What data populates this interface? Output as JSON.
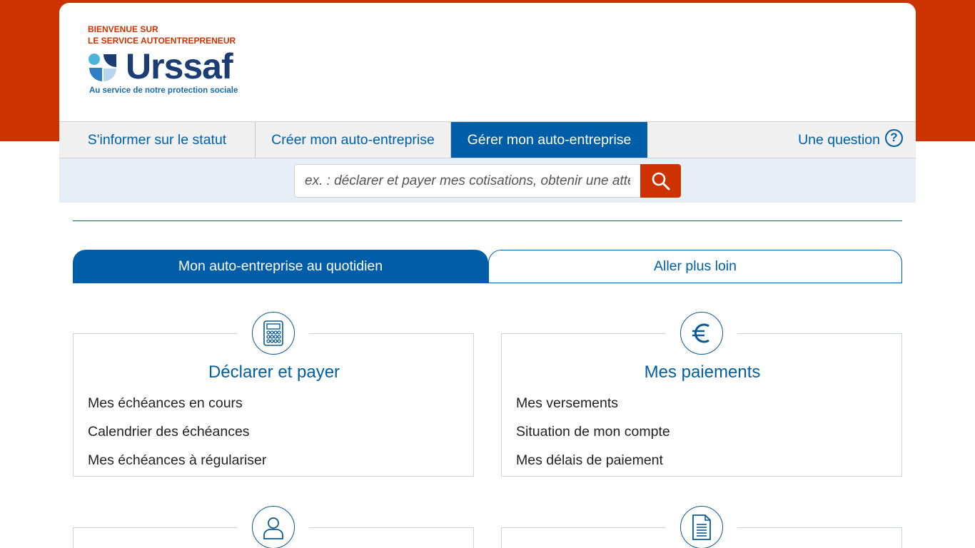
{
  "header": {
    "welcome_line1": "BIENVENUE SUR",
    "welcome_line2": "LE SERVICE AUTOENTREPRENEUR",
    "logo_text": "Urssaf",
    "tagline": "Au service de notre protection sociale",
    "brand_color": "#cc3300"
  },
  "nav": {
    "items": [
      {
        "label": "S'informer sur le statut"
      },
      {
        "label": "Créer mon auto-entreprise"
      },
      {
        "label": "Gérer mon auto-entreprise"
      }
    ],
    "question_label": "Une question",
    "question_icon": "?"
  },
  "search": {
    "placeholder": "ex. : déclarer et payer mes cotisations, obtenir une attestation",
    "button_icon": "search-icon"
  },
  "tabs": [
    {
      "label": "Mon auto-entreprise au quotidien"
    },
    {
      "label": "Aller plus loin"
    }
  ],
  "cards": [
    {
      "icon": "calculator-icon",
      "title": "Déclarer et payer",
      "links": [
        "Mes échéances en cours",
        "Calendrier des échéances",
        "Mes échéances à régulariser"
      ]
    },
    {
      "icon": "euro-icon",
      "title": "Mes paiements",
      "links": [
        "Mes versements",
        "Situation de mon compte",
        "Mes délais de paiement"
      ]
    },
    {
      "icon": "user-icon"
    },
    {
      "icon": "document-icon"
    }
  ],
  "colors": {
    "primary_blue": "#005ea8",
    "link_blue": "#005fa3",
    "search_bg": "#e8eef5"
  }
}
